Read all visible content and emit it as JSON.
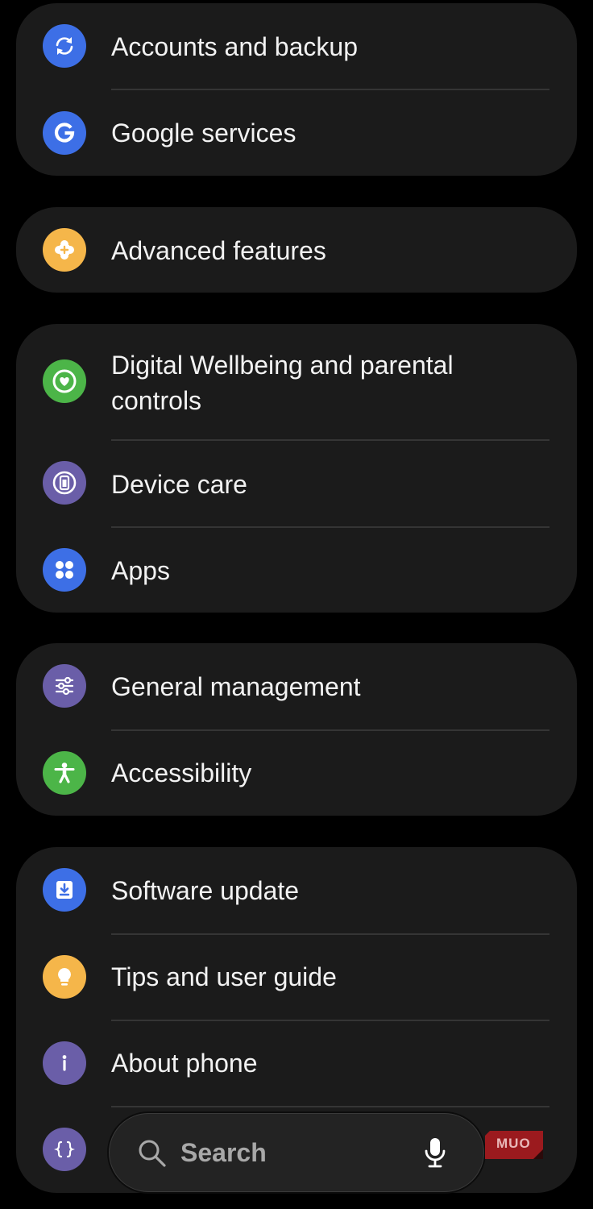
{
  "settings": {
    "accounts_backup": {
      "label": "Accounts and backup",
      "icon": "sync-icon",
      "color": "#3d6fe6"
    },
    "google_services": {
      "label": "Google services",
      "icon": "google-g-icon",
      "color": "#3d6fe6"
    },
    "advanced_features": {
      "label": "Advanced features",
      "icon": "puzzle-plus-icon",
      "color": "#f5b64a"
    },
    "digital_wellbeing": {
      "label": "Digital Wellbeing and parental controls",
      "icon": "heart-ring-icon",
      "color": "#4cb548"
    },
    "device_care": {
      "label": "Device care",
      "icon": "battery-ring-icon",
      "color": "#6a5ea8"
    },
    "apps": {
      "label": "Apps",
      "icon": "four-dots-icon",
      "color": "#3d6fe6"
    },
    "general_management": {
      "label": "General management",
      "icon": "sliders-icon",
      "color": "#6a5ea8"
    },
    "accessibility": {
      "label": "Accessibility",
      "icon": "person-icon",
      "color": "#4cb548"
    },
    "software_update": {
      "label": "Software update",
      "icon": "download-icon",
      "color": "#3d6fe6"
    },
    "tips": {
      "label": "Tips and user guide",
      "icon": "lightbulb-icon",
      "color": "#f5b64a"
    },
    "about_phone": {
      "label": "About phone",
      "icon": "info-icon",
      "color": "#6a5ea8"
    },
    "developer_options": {
      "label": "",
      "icon": "braces-icon",
      "color": "#6a5ea8"
    }
  },
  "search": {
    "label": "Search",
    "icon": "search-icon",
    "voice_icon": "microphone-icon"
  },
  "watermark": {
    "text": "MUO",
    "color": "#b5171c"
  }
}
